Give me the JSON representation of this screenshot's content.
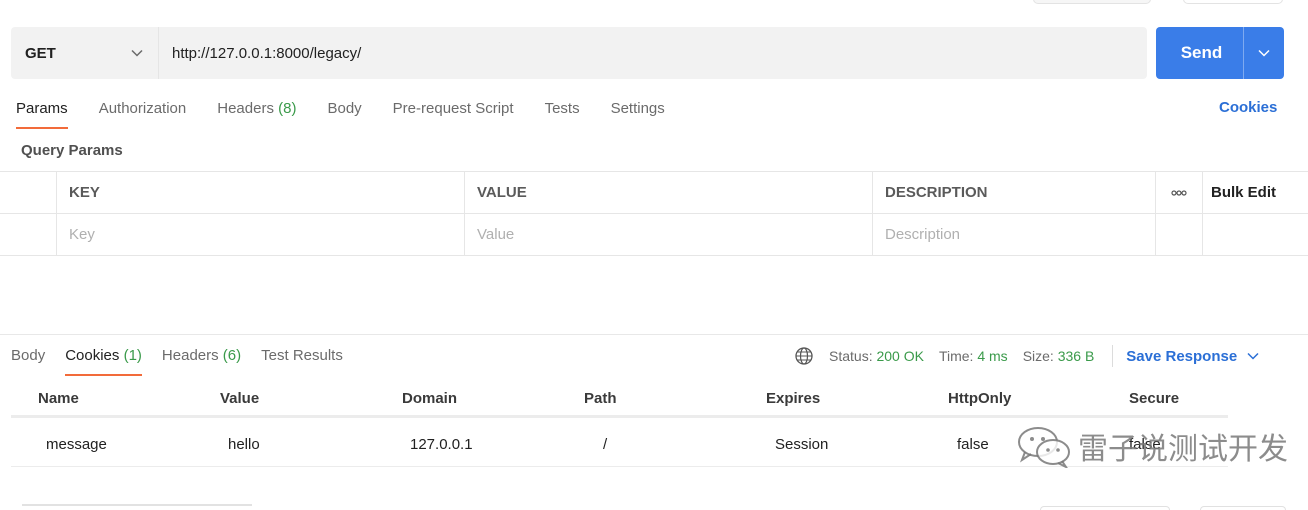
{
  "request": {
    "method": "GET",
    "url": "http://127.0.0.1:8000/legacy/",
    "send_label": "Send"
  },
  "request_tabs": [
    {
      "label": "Params",
      "active": true
    },
    {
      "label": "Authorization"
    },
    {
      "label": "Headers",
      "count": "(8)"
    },
    {
      "label": "Body"
    },
    {
      "label": "Pre-request Script"
    },
    {
      "label": "Tests"
    },
    {
      "label": "Settings"
    }
  ],
  "cookies_link": "Cookies",
  "query_params": {
    "title": "Query Params",
    "columns": [
      "KEY",
      "VALUE",
      "DESCRIPTION"
    ],
    "more_label": "ooo",
    "bulk_edit": "Bulk Edit",
    "placeholders": {
      "key": "Key",
      "value": "Value",
      "description": "Description"
    }
  },
  "response_tabs": [
    {
      "label": "Body"
    },
    {
      "label": "Cookies",
      "count": "(1)",
      "active": true
    },
    {
      "label": "Headers",
      "count": "(6)"
    },
    {
      "label": "Test Results"
    }
  ],
  "response_status": {
    "status_label": "Status:",
    "status_value": "200 OK",
    "time_label": "Time:",
    "time_value": "4 ms",
    "size_label": "Size:",
    "size_value": "336 B",
    "save_response": "Save Response"
  },
  "cookies_table": {
    "columns": [
      "Name",
      "Value",
      "Domain",
      "Path",
      "Expires",
      "HttpOnly",
      "Secure"
    ],
    "rows": [
      [
        "message",
        "hello",
        "127.0.0.1",
        "/",
        "Session",
        "false",
        "false"
      ]
    ]
  },
  "watermark": "雷子说测试开发",
  "colors": {
    "accent": "#3a7de8",
    "tab_underline": "#f26b3a",
    "link": "#2b6fd6",
    "count_green": "#3a9a4a"
  }
}
